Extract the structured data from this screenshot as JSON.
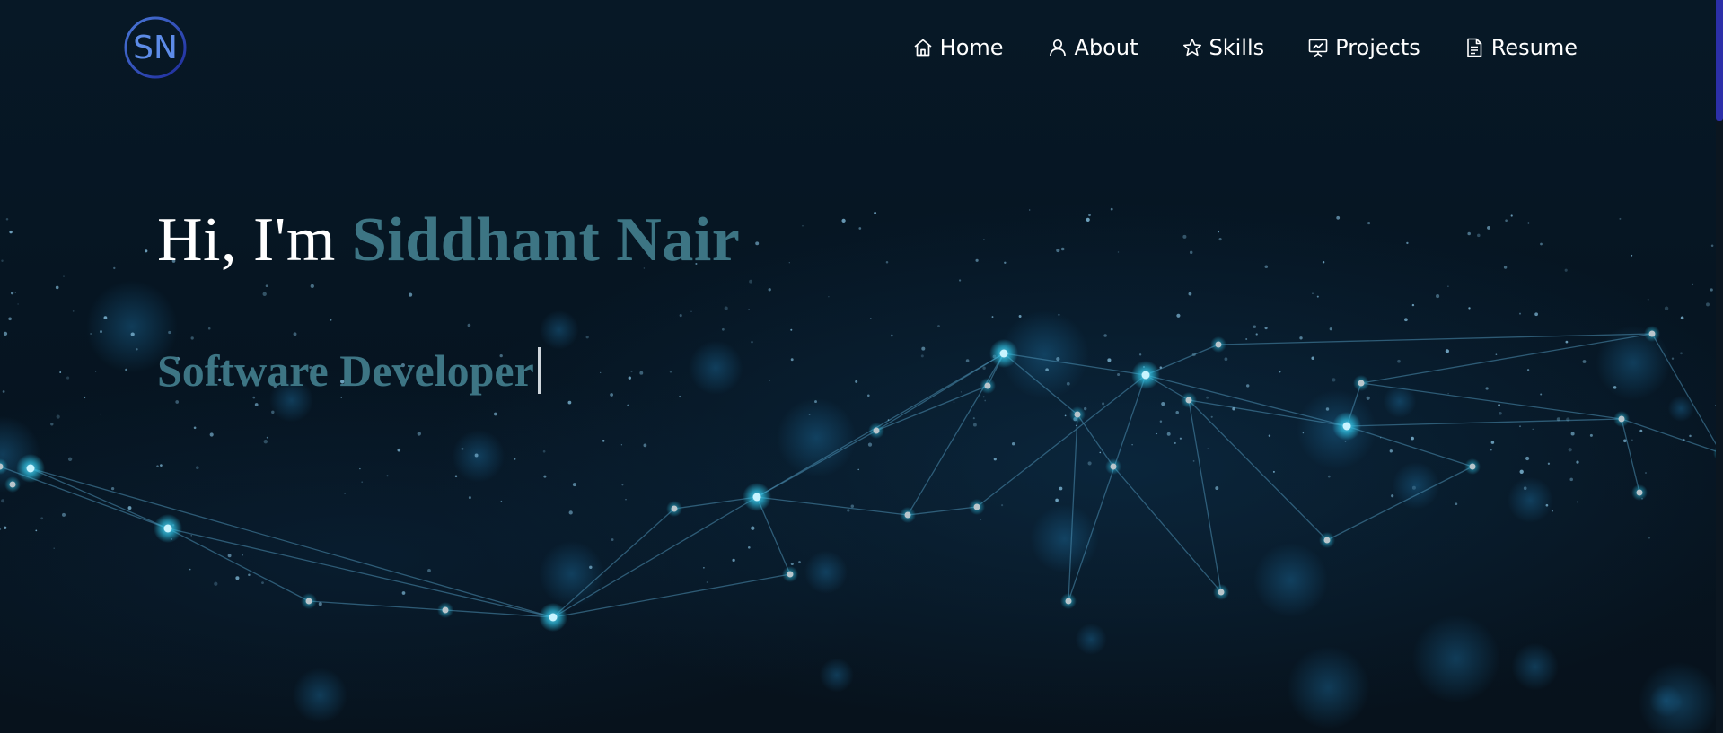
{
  "header": {
    "logo_text": "SN",
    "nav": [
      {
        "label": "Home",
        "icon": "home-icon"
      },
      {
        "label": "About",
        "icon": "user-icon"
      },
      {
        "label": "Skills",
        "icon": "star-icon"
      },
      {
        "label": "Projects",
        "icon": "presentation-icon"
      },
      {
        "label": "Resume",
        "icon": "document-icon"
      }
    ]
  },
  "hero": {
    "greeting": "Hi, I'm ",
    "name": "Siddhant Nair",
    "role": "Software Developer"
  },
  "colors": {
    "background": "#06121d",
    "accent": "#3d7584",
    "scroll_thumb": "#2c2fa8",
    "node_glow": "#2fc4e6"
  }
}
